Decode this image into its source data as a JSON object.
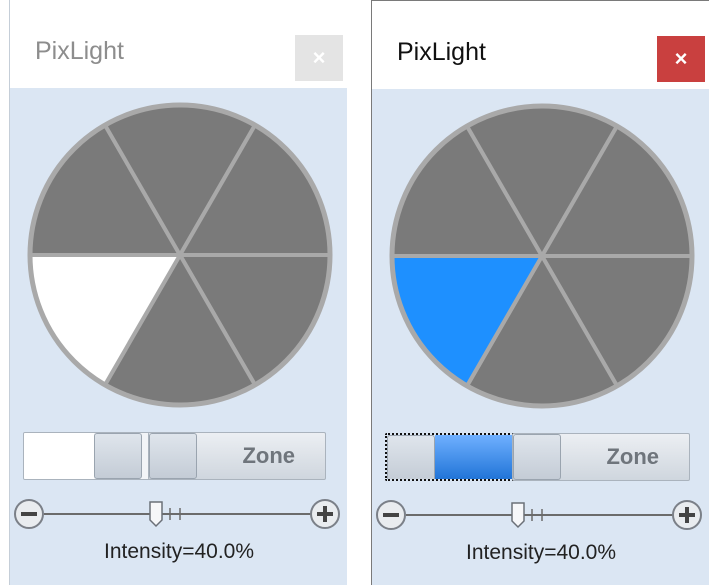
{
  "panels": [
    {
      "id": "inactive",
      "title": "PixLight",
      "close_glyph": "×",
      "active": false,
      "highlight_color": "#ffffff",
      "wheel_color": "#7a7a7a",
      "toggle": {
        "state": "off"
      },
      "zone_label": "Zone",
      "intensity_label": "Intensity=40.0%",
      "intensity": 0.4
    },
    {
      "id": "active",
      "title": "PixLight",
      "close_glyph": "×",
      "active": true,
      "highlight_color": "#1e90ff",
      "wheel_color": "#7a7a7a",
      "toggle": {
        "state": "on"
      },
      "zone_label": "Zone",
      "intensity_label": "Intensity=40.0%",
      "intensity": 0.4
    }
  ],
  "icons": {
    "minus": "minus-circle-icon",
    "plus": "plus-circle-icon",
    "close": "close-icon"
  },
  "colors": {
    "wheel_segment": "#7a7a7a",
    "wheel_outline": "#a9a9a9",
    "selected_blue": "#1e90ff",
    "close_red": "#c9403f"
  }
}
